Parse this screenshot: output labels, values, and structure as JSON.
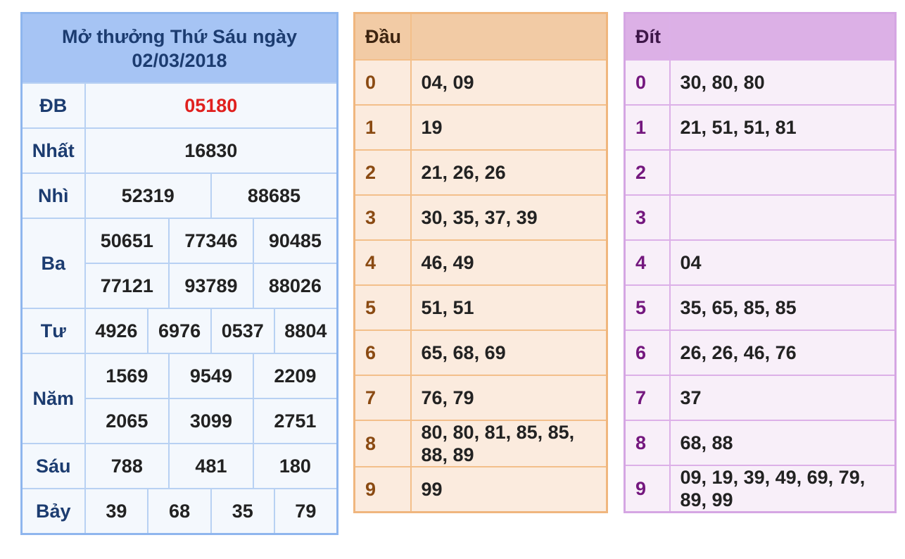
{
  "results": {
    "title_line1": "Mở thưởng Thứ Sáu ngày",
    "title_line2": "02/03/2018",
    "rows": {
      "db": {
        "label": "ĐB",
        "values": [
          "05180"
        ]
      },
      "nhat": {
        "label": "Nhất",
        "values": [
          "16830"
        ]
      },
      "nhi": {
        "label": "Nhì",
        "values": [
          "52319",
          "88685"
        ]
      },
      "ba": {
        "label": "Ba",
        "values": [
          "50651",
          "77346",
          "90485",
          "77121",
          "93789",
          "88026"
        ]
      },
      "tu": {
        "label": "Tư",
        "values": [
          "4926",
          "6976",
          "0537",
          "8804"
        ]
      },
      "nam": {
        "label": "Năm",
        "values": [
          "1569",
          "9549",
          "2209",
          "2065",
          "3099",
          "2751"
        ]
      },
      "sau": {
        "label": "Sáu",
        "values": [
          "788",
          "481",
          "180"
        ]
      },
      "bay": {
        "label": "Bảy",
        "values": [
          "39",
          "68",
          "35",
          "79"
        ]
      }
    }
  },
  "dau": {
    "header": "Đầu",
    "rows": [
      {
        "digit": "0",
        "values": "04, 09"
      },
      {
        "digit": "1",
        "values": "19"
      },
      {
        "digit": "2",
        "values": "21, 26, 26"
      },
      {
        "digit": "3",
        "values": "30, 35, 37, 39"
      },
      {
        "digit": "4",
        "values": "46, 49"
      },
      {
        "digit": "5",
        "values": "51, 51"
      },
      {
        "digit": "6",
        "values": "65, 68, 69"
      },
      {
        "digit": "7",
        "values": "76, 79"
      },
      {
        "digit": "8",
        "values": "80, 80, 81, 85, 85, 88, 89"
      },
      {
        "digit": "9",
        "values": "99"
      }
    ]
  },
  "dit": {
    "header": "Đít",
    "rows": [
      {
        "digit": "0",
        "values": "30, 80, 80"
      },
      {
        "digit": "1",
        "values": "21, 51, 51, 81"
      },
      {
        "digit": "2",
        "values": ""
      },
      {
        "digit": "3",
        "values": ""
      },
      {
        "digit": "4",
        "values": "04"
      },
      {
        "digit": "5",
        "values": "35, 65, 85, 85"
      },
      {
        "digit": "6",
        "values": "26, 26, 46, 76"
      },
      {
        "digit": "7",
        "values": "37"
      },
      {
        "digit": "8",
        "values": "68, 88"
      },
      {
        "digit": "9",
        "values": "09, 19, 39, 49, 69, 79, 89, 99"
      }
    ]
  },
  "colors": {
    "special_prize": "#e0201e",
    "results_header": "#a6c4f4",
    "dau_header": "#f2cba5",
    "dit_header": "#dcb0e6"
  }
}
